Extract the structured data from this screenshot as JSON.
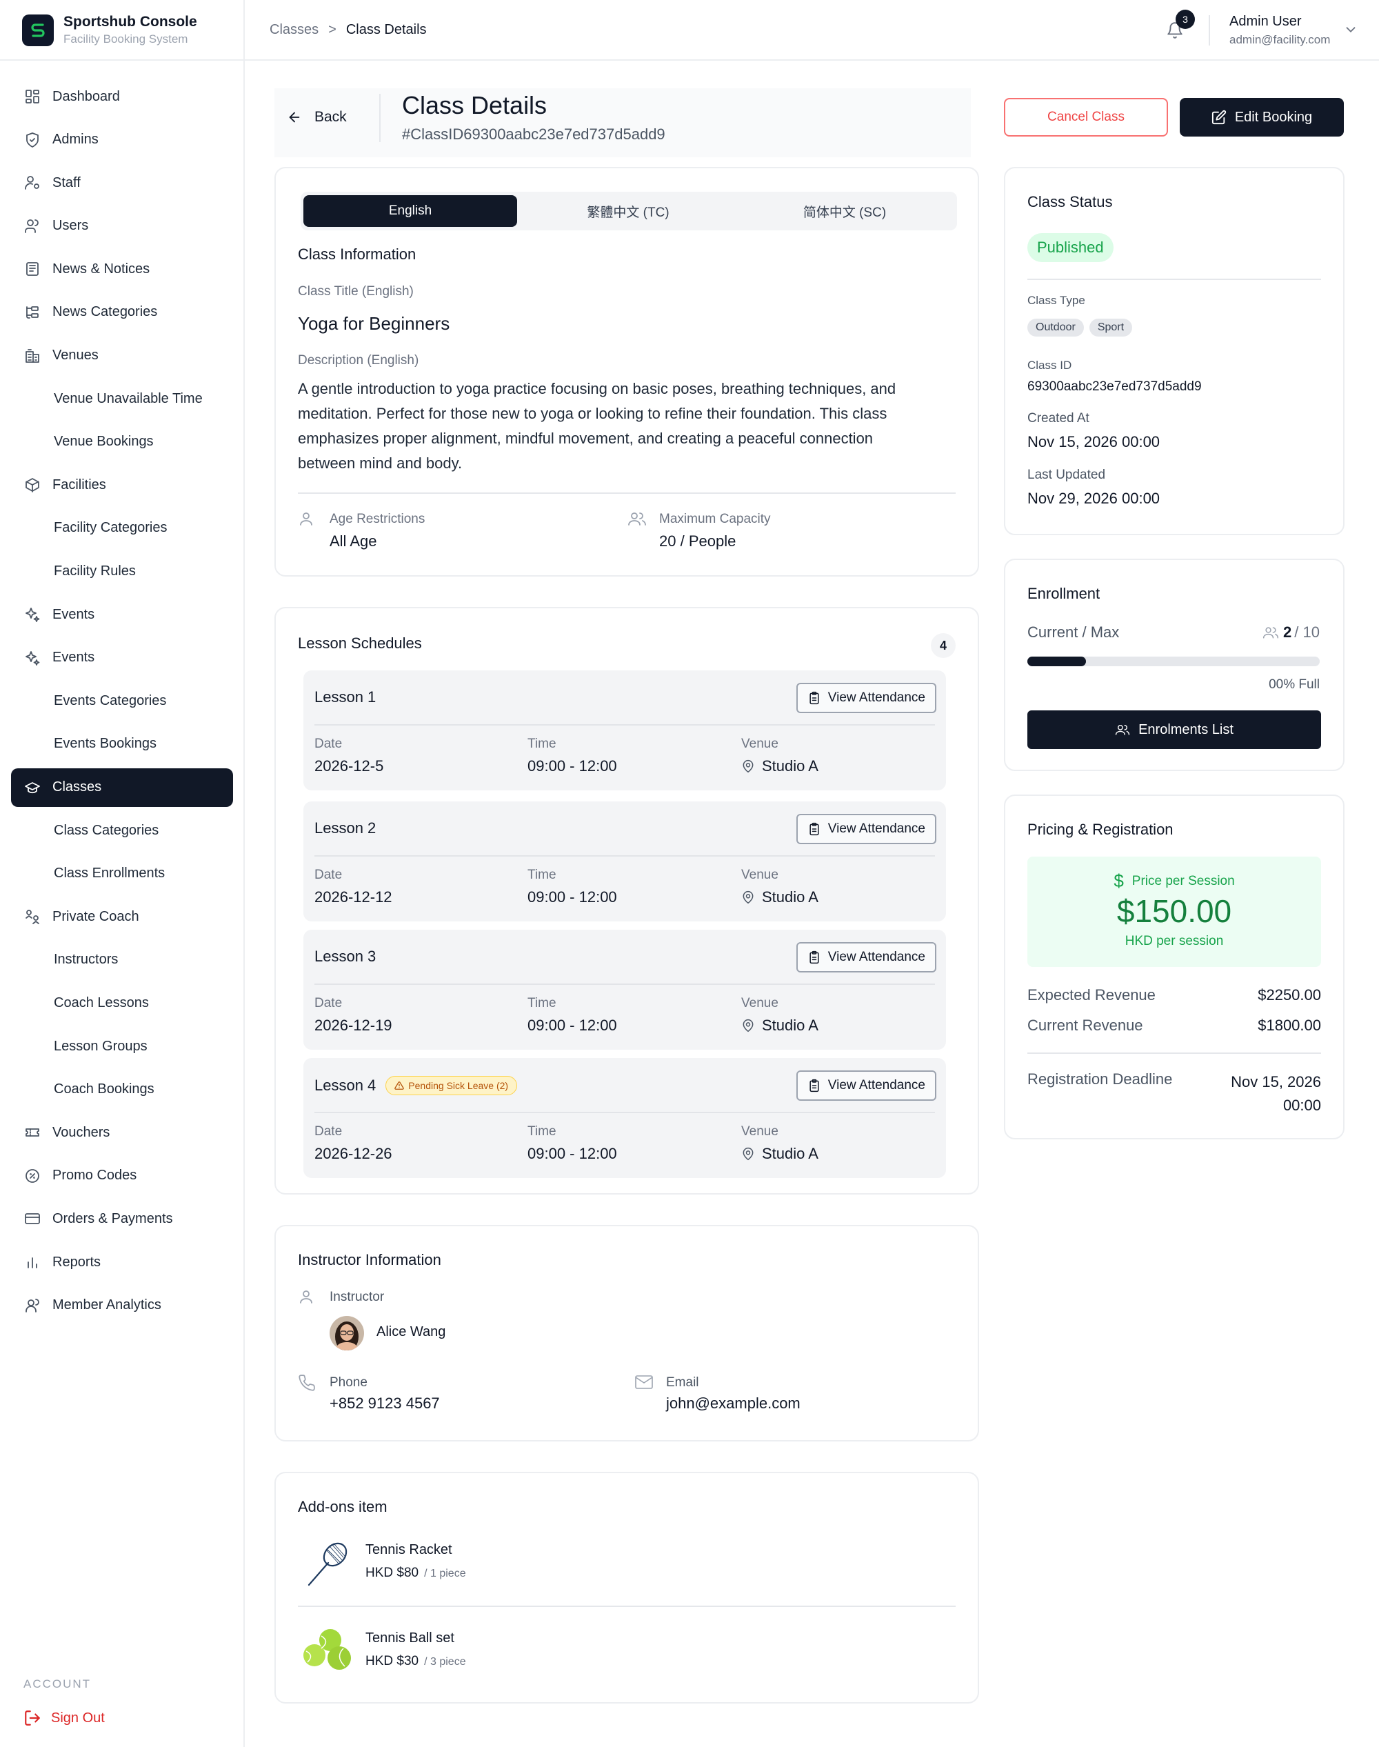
{
  "brand": {
    "title": "Sportshub Console",
    "subtitle": "Facility Booking System"
  },
  "sidebar": {
    "items": [
      {
        "label": "Dashboard",
        "icon": "dashboard-icon",
        "sub": false
      },
      {
        "label": "Admins",
        "icon": "shield-icon",
        "sub": false
      },
      {
        "label": "Staff",
        "icon": "staff-icon",
        "sub": false
      },
      {
        "label": "Users",
        "icon": "users-icon",
        "sub": false
      },
      {
        "label": "News & Notices",
        "icon": "newspaper-icon",
        "sub": false
      },
      {
        "label": "News Categories",
        "icon": "categories-icon",
        "sub": false
      },
      {
        "label": "Venues",
        "icon": "building-icon",
        "sub": false
      },
      {
        "label": "Venue Unavailable Time",
        "icon": "",
        "sub": true
      },
      {
        "label": "Venue Bookings",
        "icon": "",
        "sub": true
      },
      {
        "label": "Facilities",
        "icon": "box-icon",
        "sub": false
      },
      {
        "label": "Facility Categories",
        "icon": "",
        "sub": true
      },
      {
        "label": "Facility Rules",
        "icon": "",
        "sub": true
      },
      {
        "label": "Events",
        "icon": "sparkle-icon",
        "sub": false
      },
      {
        "label": "Events",
        "icon": "sparkle-icon",
        "sub": false
      },
      {
        "label": "Events Categories",
        "icon": "",
        "sub": true
      },
      {
        "label": "Events Bookings",
        "icon": "",
        "sub": true
      },
      {
        "label": "Classes",
        "icon": "graduation-cap-icon",
        "sub": false,
        "active": true
      },
      {
        "label": "Class Categories",
        "icon": "",
        "sub": true
      },
      {
        "label": "Class Enrollments",
        "icon": "",
        "sub": true
      },
      {
        "label": "Private Coach",
        "icon": "coach-icon",
        "sub": false
      },
      {
        "label": "Instructors",
        "icon": "",
        "sub": true
      },
      {
        "label": "Coach Lessons",
        "icon": "",
        "sub": true
      },
      {
        "label": "Lesson Groups",
        "icon": "",
        "sub": true
      },
      {
        "label": "Coach Bookings",
        "icon": "",
        "sub": true
      },
      {
        "label": "Vouchers",
        "icon": "ticket-icon",
        "sub": false
      },
      {
        "label": "Promo Codes",
        "icon": "percent-icon",
        "sub": false
      },
      {
        "label": "Orders & Payments",
        "icon": "credit-card-icon",
        "sub": false
      },
      {
        "label": "Reports",
        "icon": "bar-chart-icon",
        "sub": false
      },
      {
        "label": "Member Analytics",
        "icon": "member-icon",
        "sub": false
      }
    ],
    "account_label": "ACCOUNT",
    "sign_out": "Sign Out"
  },
  "topbar": {
    "breadcrumb": {
      "parent": "Classes",
      "separator": ">",
      "current": "Class Details"
    },
    "notifications": "3",
    "user_name": "Admin User",
    "user_email": "admin@facility.com"
  },
  "header": {
    "back": "Back",
    "title": "Class Details",
    "id": "#ClassID69300aabc23e7ed737d5add9",
    "cancel": "Cancel Class",
    "edit": "Edit Booking"
  },
  "info": {
    "tabs": [
      "English",
      "繁體中文 (TC)",
      "简体中文 (SC)"
    ],
    "section_title": "Class Information",
    "title_label": "Class Title (English)",
    "title_value": "Yoga for Beginners",
    "desc_label": "Description (English)",
    "desc_value": "A gentle introduction to yoga practice focusing on basic poses, breathing techniques, and meditation. Perfect for those new to yoga or looking to refine their foundation. This class emphasizes proper alignment, mindful movement, and creating a peaceful connection between mind and body.",
    "age_label": "Age Restrictions",
    "age_value": "All Age",
    "capacity_label": "Maximum Capacity",
    "capacity_value": "20",
    "capacity_unit": "/ People"
  },
  "schedules": {
    "title": "Lesson Schedules",
    "count": "4",
    "date_label": "Date",
    "time_label": "Time",
    "venue_label": "Venue",
    "attendance_label": "View Attendance",
    "lessons": [
      {
        "name": "Lesson 1",
        "date": "2026-12-5",
        "time": "09:00 - 12:00",
        "venue": "Studio A",
        "badge": ""
      },
      {
        "name": "Lesson 2",
        "date": "2026-12-12",
        "time": "09:00 - 12:00",
        "venue": "Studio A",
        "badge": ""
      },
      {
        "name": "Lesson 3",
        "date": "2026-12-19",
        "time": "09:00 - 12:00",
        "venue": "Studio A",
        "badge": ""
      },
      {
        "name": "Lesson 4",
        "date": "2026-12-26",
        "time": "09:00 - 12:00",
        "venue": "Studio A",
        "badge": "Pending Sick Leave (2)"
      }
    ]
  },
  "instructor": {
    "title": "Instructor Information",
    "label": "Instructor",
    "name": "Alice Wang",
    "phone_label": "Phone",
    "phone": "+852 9123 4567",
    "email_label": "Email",
    "email": "john@example.com"
  },
  "addons": {
    "title": "Add-ons item",
    "items": [
      {
        "name": "Tennis Racket",
        "price": "HKD $80",
        "unit": "/ 1 piece",
        "icon": "tennis-racket-icon"
      },
      {
        "name": "Tennis Ball set",
        "price": "HKD $30",
        "unit": "/ 3 piece",
        "icon": "tennis-balls-icon"
      }
    ]
  },
  "status": {
    "title": "Class Status",
    "status": "Published",
    "type_label": "Class Type",
    "types": [
      "Outdoor",
      "Sport"
    ],
    "id_label": "Class ID",
    "id_value": "69300aabc23e7ed737d5add9",
    "created_label": "Created At",
    "created_value": "Nov 15, 2026 00:00",
    "updated_label": "Last Updated",
    "updated_value": "Nov 29, 2026 00:00"
  },
  "enrollment": {
    "title": "Enrollment",
    "label": "Current / Max",
    "current": "2",
    "max": "/ 10",
    "progress_fraction": 0.2,
    "full_text": "00% Full",
    "button": "Enrolments List"
  },
  "pricing": {
    "title": "Pricing & Registration",
    "price_label": "Price per Session",
    "price": "$150.00",
    "price_sub": "HKD per session",
    "expected_label": "Expected Revenue",
    "expected_value": "$2250.00",
    "current_label": "Current Revenue",
    "current_value": "$1800.00",
    "deadline_label": "Registration Deadline",
    "deadline_date": "Nov 15, 2026",
    "deadline_time": "00:00"
  },
  "colors": {
    "primary": "#111827",
    "danger": "#ef4444",
    "success": "#16a34a",
    "success_bg": "#ecfdf3",
    "warning": "#b45309"
  }
}
